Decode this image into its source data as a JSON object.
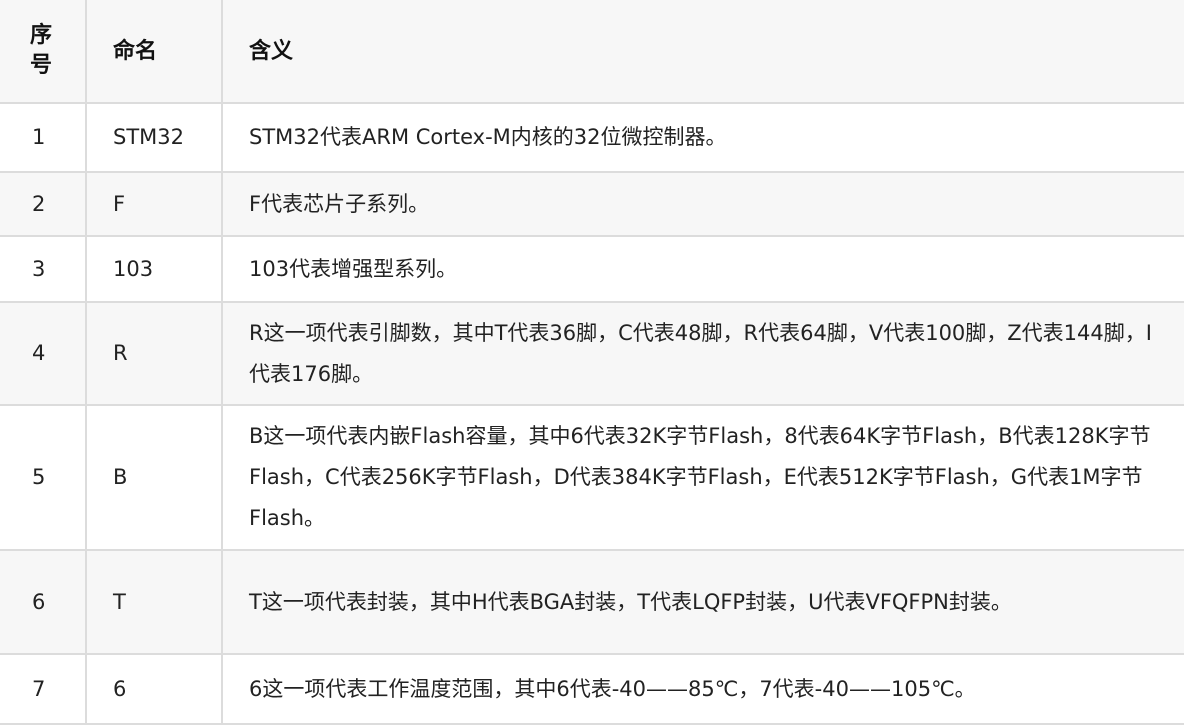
{
  "table": {
    "headers": [
      "序号",
      "命名",
      "含义"
    ],
    "rows": [
      {
        "num": "1",
        "name": "STM32",
        "meaning": "STM32代表ARM Cortex-M内核的32位微控制器。"
      },
      {
        "num": "2",
        "name": "F",
        "meaning": "F代表芯片子系列。"
      },
      {
        "num": "3",
        "name": "103",
        "meaning": "103代表增强型系列。"
      },
      {
        "num": "4",
        "name": "R",
        "meaning": "R这一项代表引脚数，其中T代表36脚，C代表48脚，R代表64脚，V代表100脚，Z代表144脚，I代表176脚。"
      },
      {
        "num": "5",
        "name": "B",
        "meaning": "B这一项代表内嵌Flash容量，其中6代表32K字节Flash，8代表64K字节Flash，B代表128K字节Flash，C代表256K字节Flash，D代表384K字节Flash，E代表512K字节Flash，G代表1M字节Flash。"
      },
      {
        "num": "6",
        "name": "T",
        "meaning": "T这一项代表封装，其中H代表BGA封装，T代表LQFP封装，U代表VFQFPN封装。"
      },
      {
        "num": "7",
        "name": "6",
        "meaning": "6这一项代表工作温度范围，其中6代表-40——85℃，7代表-40——105℃。"
      }
    ]
  }
}
